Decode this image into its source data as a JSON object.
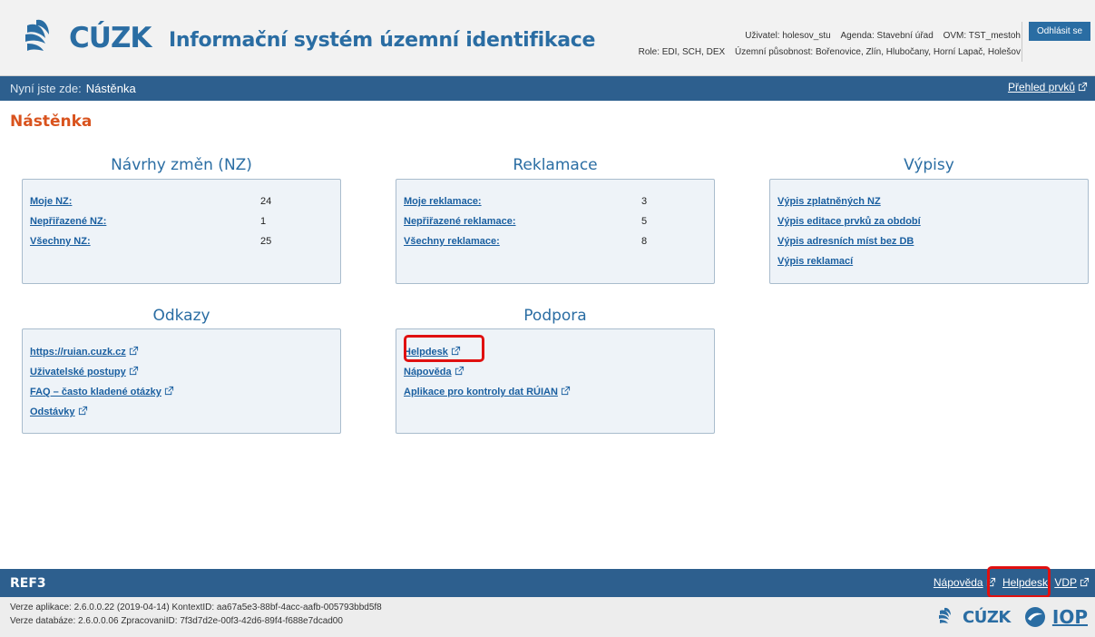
{
  "header": {
    "logo_text": "ÚZK",
    "logo_letter": "C",
    "app_title": "Informační systém územní identifikace",
    "user": "Uživatel: holesov_stu",
    "agenda": "Agenda: Stavební úřad",
    "ovm": "OVM: TST_mestoh",
    "role": "Role: EDI, SCH, DEX",
    "territory": "Územní působnost: Bořenovice, Zlín, Hlubočany, Horní Lapač, Holešov",
    "logout_label": "Odhlásit se"
  },
  "breadcrumb": {
    "prefix": "Nyní jste zde:",
    "current": "Nástěnka",
    "overview_link": "Přehled prvků"
  },
  "page_title": "Nástěnka",
  "sections": {
    "nz": {
      "title": "Návrhy změn (NZ)",
      "rows": [
        {
          "label": "Moje NZ:",
          "count": "24"
        },
        {
          "label": "Nepřiřazené NZ:",
          "count": "1"
        },
        {
          "label": "Všechny NZ:",
          "count": "25"
        }
      ]
    },
    "complaints": {
      "title": "Reklamace",
      "rows": [
        {
          "label": "Moje reklamace:",
          "count": "3"
        },
        {
          "label": "Nepřiřazené reklamace:",
          "count": "5"
        },
        {
          "label": "Všechny reklamace:",
          "count": "8"
        }
      ]
    },
    "listings": {
      "title": "Výpisy",
      "links": [
        "Výpis zplatněných NZ",
        "Výpis editace prvků za období",
        "Výpis adresních míst bez DB",
        "Výpis reklamací"
      ]
    },
    "links": {
      "title": "Odkazy",
      "links": [
        "https://ruian.cuzk.cz",
        "Uživatelské postupy",
        "FAQ – často kladené otázky",
        "Odstávky"
      ]
    },
    "support": {
      "title": "Podpora",
      "links": [
        "Helpdesk",
        "Nápověda",
        "Aplikace pro kontroly dat RÚIAN"
      ]
    }
  },
  "footer": {
    "environment": "REF3",
    "links": [
      "Nápověda",
      "Helpdesk",
      "VDP"
    ],
    "app_version": "Verze aplikace: 2.6.0.0.22 (2019-04-14) KontextID: aa67a5e3-88bf-4acc-aafb-005793bbd5f8",
    "db_version": "Verze databáze: 2.6.0.0.06 ZpracovaniID: 7f3d7d2e-00f3-42d6-89f4-f688e7dcad00",
    "logo_text": "ÚZK",
    "logo_letter": "C",
    "iop": "IOP"
  },
  "colors": {
    "brand_blue": "#2a6da3",
    "bar_blue": "#2d5f8e",
    "title_orange": "#d9531e",
    "highlight_red": "#e01010"
  }
}
